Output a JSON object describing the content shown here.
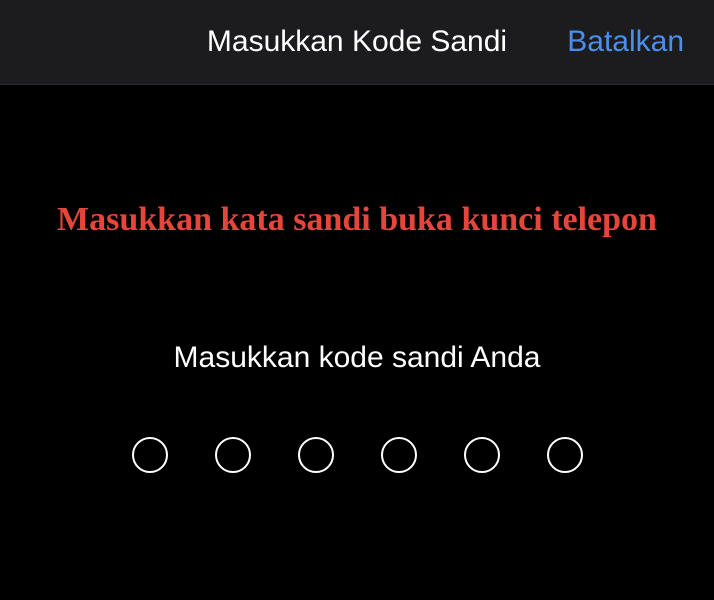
{
  "navbar": {
    "title": "Masukkan Kode Sandi",
    "cancel_label": "Batalkan"
  },
  "warning_text": "Masukkan kata sandi buka kunci telepon",
  "prompt": "Masukkan kode sandi Anda",
  "passcode": {
    "length": 6,
    "entered": 0
  },
  "colors": {
    "accent": "#4a8ff0",
    "warning": "#e5453a",
    "navbar_bg": "#1c1c1e",
    "background": "#000000"
  }
}
